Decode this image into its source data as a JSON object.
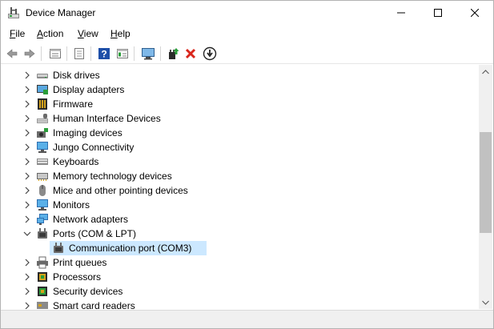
{
  "window": {
    "title": "Device Manager",
    "icon": "device-manager-icon"
  },
  "menu": {
    "items": [
      "File",
      "Action",
      "View",
      "Help"
    ]
  },
  "toolbar": {
    "buttons": [
      "back-arrow-icon",
      "forward-arrow-icon",
      "properties-icon",
      "show-hidden-icon",
      "help-icon",
      "console-tree-icon",
      "scan-hardware-icon",
      "update-driver-icon",
      "uninstall-icon",
      "disable-device-icon"
    ]
  },
  "tree": {
    "items": [
      {
        "label": "Disk drives",
        "icon": "disk-drive-icon",
        "expanded": false
      },
      {
        "label": "Display adapters",
        "icon": "display-adapter-icon",
        "expanded": false
      },
      {
        "label": "Firmware",
        "icon": "firmware-icon",
        "expanded": false
      },
      {
        "label": "Human Interface Devices",
        "icon": "hid-icon",
        "expanded": false
      },
      {
        "label": "Imaging devices",
        "icon": "camera-icon",
        "expanded": false
      },
      {
        "label": "Jungo Connectivity",
        "icon": "monitor-icon",
        "expanded": false
      },
      {
        "label": "Keyboards",
        "icon": "keyboard-icon",
        "expanded": false
      },
      {
        "label": "Memory technology devices",
        "icon": "memory-icon",
        "expanded": false
      },
      {
        "label": "Mice and other pointing devices",
        "icon": "mouse-icon",
        "expanded": false
      },
      {
        "label": "Monitors",
        "icon": "monitor-icon",
        "expanded": false
      },
      {
        "label": "Network adapters",
        "icon": "network-icon",
        "expanded": false
      },
      {
        "label": "Ports (COM & LPT)",
        "icon": "port-icon",
        "expanded": true
      },
      {
        "label": "Communication port (COM3)",
        "icon": "port-icon",
        "child": true,
        "selected": true
      },
      {
        "label": "Print queues",
        "icon": "printer-icon",
        "expanded": false
      },
      {
        "label": "Processors",
        "icon": "processor-icon",
        "expanded": false
      },
      {
        "label": "Security devices",
        "icon": "security-chip-icon",
        "expanded": false
      },
      {
        "label": "Smart card readers",
        "icon": "smart-card-icon",
        "expanded": false
      }
    ]
  },
  "colors": {
    "selection": "#cce8ff",
    "scroll_thumb": "#c1c1c1",
    "accent_blue": "#1e6fc8",
    "remove_red": "#d9261c",
    "scan_green": "#2a9d3a"
  }
}
